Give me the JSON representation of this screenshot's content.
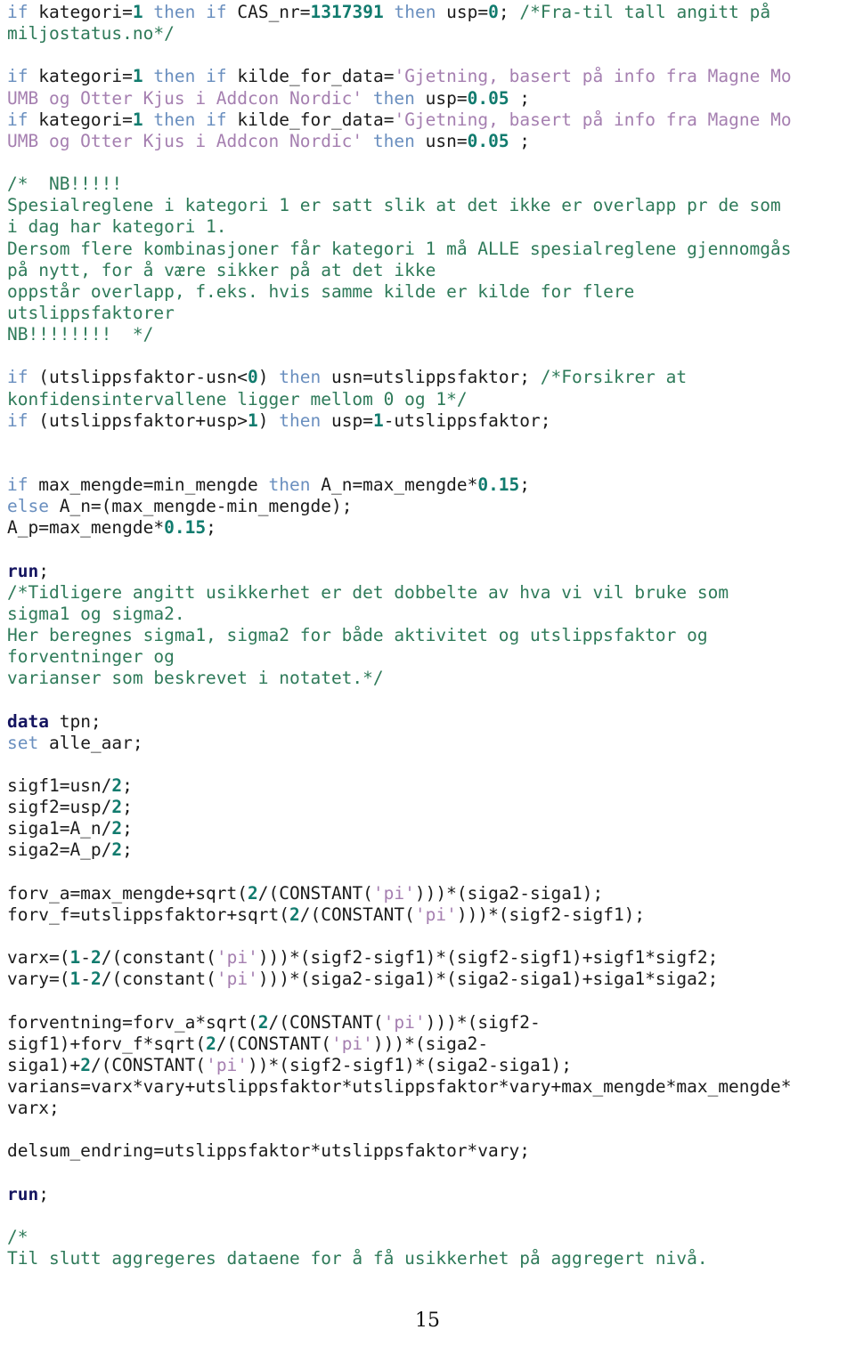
{
  "document": {
    "kind": "sas-code-listing",
    "page_number": "15",
    "colors": {
      "background": "#ffffff",
      "plain_text": "#1b1b1b",
      "keyword": "#6a8fbf",
      "statement": "#151560",
      "number": "#117b6e",
      "string": "#a57fb0",
      "comment": "#2e7a59"
    }
  },
  "code": {
    "lines": [
      {
        "id": "l1",
        "tokens": [
          {
            "t": "if ",
            "c": "kw"
          },
          {
            "t": "kategori=",
            "c": "plain"
          },
          {
            "t": "1",
            "c": "num"
          },
          {
            "t": " ",
            "c": "plain"
          },
          {
            "t": "then",
            "c": "kw"
          },
          {
            "t": " ",
            "c": "plain"
          },
          {
            "t": "if",
            "c": "kw"
          },
          {
            "t": " CAS_nr=",
            "c": "plain"
          },
          {
            "t": "1317391",
            "c": "num"
          },
          {
            "t": " ",
            "c": "plain"
          },
          {
            "t": "then",
            "c": "kw"
          },
          {
            "t": " usp=",
            "c": "plain"
          },
          {
            "t": "0",
            "c": "num"
          },
          {
            "t": "; ",
            "c": "plain"
          },
          {
            "t": "/*Fra-til tall angitt på",
            "c": "cmt"
          }
        ]
      },
      {
        "id": "l2",
        "tokens": [
          {
            "t": "miljostatus.no*/",
            "c": "cmt"
          }
        ]
      },
      {
        "id": "l3",
        "tokens": []
      },
      {
        "id": "l4",
        "tokens": [
          {
            "t": "if ",
            "c": "kw"
          },
          {
            "t": "kategori=",
            "c": "plain"
          },
          {
            "t": "1",
            "c": "num"
          },
          {
            "t": " ",
            "c": "plain"
          },
          {
            "t": "then",
            "c": "kw"
          },
          {
            "t": " ",
            "c": "plain"
          },
          {
            "t": "if",
            "c": "kw"
          },
          {
            "t": " kilde_for_data=",
            "c": "plain"
          },
          {
            "t": "'Gjetning, basert på info fra Magne Mo",
            "c": "str"
          }
        ]
      },
      {
        "id": "l5",
        "tokens": [
          {
            "t": "UMB og Otter Kjus i Addcon Nordic'",
            "c": "str"
          },
          {
            "t": " ",
            "c": "plain"
          },
          {
            "t": "then",
            "c": "kw"
          },
          {
            "t": " usp=",
            "c": "plain"
          },
          {
            "t": "0.05",
            "c": "num"
          },
          {
            "t": " ;",
            "c": "plain"
          }
        ]
      },
      {
        "id": "l6",
        "tokens": [
          {
            "t": "if ",
            "c": "kw"
          },
          {
            "t": "kategori=",
            "c": "plain"
          },
          {
            "t": "1",
            "c": "num"
          },
          {
            "t": " ",
            "c": "plain"
          },
          {
            "t": "then",
            "c": "kw"
          },
          {
            "t": " ",
            "c": "plain"
          },
          {
            "t": "if",
            "c": "kw"
          },
          {
            "t": " kilde_for_data=",
            "c": "plain"
          },
          {
            "t": "'Gjetning, basert på info fra Magne Mo",
            "c": "str"
          }
        ]
      },
      {
        "id": "l7",
        "tokens": [
          {
            "t": "UMB og Otter Kjus i Addcon Nordic'",
            "c": "str"
          },
          {
            "t": " ",
            "c": "plain"
          },
          {
            "t": "then",
            "c": "kw"
          },
          {
            "t": " usn=",
            "c": "plain"
          },
          {
            "t": "0.05",
            "c": "num"
          },
          {
            "t": " ;",
            "c": "plain"
          }
        ]
      },
      {
        "id": "l8",
        "tokens": []
      },
      {
        "id": "l9",
        "tokens": [
          {
            "t": "/*  NB!!!!!",
            "c": "cmt"
          }
        ]
      },
      {
        "id": "l10",
        "tokens": [
          {
            "t": "Spesialreglene i kategori 1 er satt slik at det ikke er overlapp pr de som",
            "c": "cmt"
          }
        ]
      },
      {
        "id": "l11",
        "tokens": [
          {
            "t": "i dag har kategori 1.",
            "c": "cmt"
          }
        ]
      },
      {
        "id": "l12",
        "tokens": [
          {
            "t": "Dersom flere kombinasjoner får kategori 1 må ALLE spesialreglene gjennomgås",
            "c": "cmt"
          }
        ]
      },
      {
        "id": "l13",
        "tokens": [
          {
            "t": "på nytt, for å være sikker på at det ikke",
            "c": "cmt"
          }
        ]
      },
      {
        "id": "l14",
        "tokens": [
          {
            "t": "oppstår overlapp, f.eks. hvis samme kilde er kilde for flere",
            "c": "cmt"
          }
        ]
      },
      {
        "id": "l15",
        "tokens": [
          {
            "t": "utslippsfaktorer",
            "c": "cmt"
          }
        ]
      },
      {
        "id": "l16",
        "tokens": [
          {
            "t": "NB!!!!!!!!  */",
            "c": "cmt"
          }
        ]
      },
      {
        "id": "l17",
        "tokens": []
      },
      {
        "id": "l18",
        "tokens": [
          {
            "t": "if",
            "c": "kw"
          },
          {
            "t": " (utslippsfaktor-usn<",
            "c": "plain"
          },
          {
            "t": "0",
            "c": "num"
          },
          {
            "t": ") ",
            "c": "plain"
          },
          {
            "t": "then",
            "c": "kw"
          },
          {
            "t": " usn=utslippsfaktor; ",
            "c": "plain"
          },
          {
            "t": "/*Forsikrer at",
            "c": "cmt"
          }
        ]
      },
      {
        "id": "l19",
        "tokens": [
          {
            "t": "konfidensintervallene ligger mellom 0 og 1*/",
            "c": "cmt"
          }
        ]
      },
      {
        "id": "l20",
        "tokens": [
          {
            "t": "if",
            "c": "kw"
          },
          {
            "t": " (utslippsfaktor+usp>",
            "c": "plain"
          },
          {
            "t": "1",
            "c": "num"
          },
          {
            "t": ") ",
            "c": "plain"
          },
          {
            "t": "then",
            "c": "kw"
          },
          {
            "t": " usp=",
            "c": "plain"
          },
          {
            "t": "1",
            "c": "num"
          },
          {
            "t": "-utslippsfaktor;",
            "c": "plain"
          }
        ]
      },
      {
        "id": "l21",
        "tokens": []
      },
      {
        "id": "l22",
        "tokens": []
      },
      {
        "id": "l23",
        "tokens": [
          {
            "t": "if",
            "c": "kw"
          },
          {
            "t": " max_mengde=min_mengde ",
            "c": "plain"
          },
          {
            "t": "then",
            "c": "kw"
          },
          {
            "t": " A_n=max_mengde*",
            "c": "plain"
          },
          {
            "t": "0.15",
            "c": "num"
          },
          {
            "t": ";",
            "c": "plain"
          }
        ]
      },
      {
        "id": "l24",
        "tokens": [
          {
            "t": "else",
            "c": "kw"
          },
          {
            "t": " A_n=(max_mengde-min_mengde);",
            "c": "plain"
          }
        ]
      },
      {
        "id": "l25",
        "tokens": [
          {
            "t": "A_p=max_mengde*",
            "c": "plain"
          },
          {
            "t": "0.15",
            "c": "num"
          },
          {
            "t": ";",
            "c": "plain"
          }
        ]
      },
      {
        "id": "l26",
        "tokens": []
      },
      {
        "id": "l27",
        "tokens": [
          {
            "t": "run",
            "c": "stmt"
          },
          {
            "t": ";",
            "c": "plain"
          }
        ]
      },
      {
        "id": "l28",
        "tokens": [
          {
            "t": "/*Tidligere angitt usikkerhet er det dobbelte av hva vi vil bruke som",
            "c": "cmt"
          }
        ]
      },
      {
        "id": "l29",
        "tokens": [
          {
            "t": "sigma1 og sigma2.",
            "c": "cmt"
          }
        ]
      },
      {
        "id": "l30",
        "tokens": [
          {
            "t": "Her beregnes sigma1, sigma2 for både aktivitet og utslippsfaktor og",
            "c": "cmt"
          }
        ]
      },
      {
        "id": "l31",
        "tokens": [
          {
            "t": "forventninger og",
            "c": "cmt"
          }
        ]
      },
      {
        "id": "l32",
        "tokens": [
          {
            "t": "varianser som beskrevet i notatet.*/",
            "c": "cmt"
          }
        ]
      },
      {
        "id": "l33",
        "tokens": []
      },
      {
        "id": "l34",
        "tokens": [
          {
            "t": "data",
            "c": "stmt"
          },
          {
            "t": " tpn;",
            "c": "plain"
          }
        ]
      },
      {
        "id": "l35",
        "tokens": [
          {
            "t": "set",
            "c": "kw"
          },
          {
            "t": " alle_aar;",
            "c": "plain"
          }
        ]
      },
      {
        "id": "l36",
        "tokens": []
      },
      {
        "id": "l37",
        "tokens": [
          {
            "t": "sigf1=usn/",
            "c": "plain"
          },
          {
            "t": "2",
            "c": "num"
          },
          {
            "t": ";",
            "c": "plain"
          }
        ]
      },
      {
        "id": "l38",
        "tokens": [
          {
            "t": "sigf2=usp/",
            "c": "plain"
          },
          {
            "t": "2",
            "c": "num"
          },
          {
            "t": ";",
            "c": "plain"
          }
        ]
      },
      {
        "id": "l39",
        "tokens": [
          {
            "t": "siga1=A_n/",
            "c": "plain"
          },
          {
            "t": "2",
            "c": "num"
          },
          {
            "t": ";",
            "c": "plain"
          }
        ]
      },
      {
        "id": "l40",
        "tokens": [
          {
            "t": "siga2=A_p/",
            "c": "plain"
          },
          {
            "t": "2",
            "c": "num"
          },
          {
            "t": ";",
            "c": "plain"
          }
        ]
      },
      {
        "id": "l41",
        "tokens": []
      },
      {
        "id": "l42",
        "tokens": [
          {
            "t": "forv_a=max_mengde+sqrt(",
            "c": "plain"
          },
          {
            "t": "2",
            "c": "num"
          },
          {
            "t": "/(CONSTANT(",
            "c": "plain"
          },
          {
            "t": "'pi'",
            "c": "str"
          },
          {
            "t": ")))*(siga2-siga1);",
            "c": "plain"
          }
        ]
      },
      {
        "id": "l43",
        "tokens": [
          {
            "t": "forv_f=utslippsfaktor+sqrt(",
            "c": "plain"
          },
          {
            "t": "2",
            "c": "num"
          },
          {
            "t": "/(CONSTANT(",
            "c": "plain"
          },
          {
            "t": "'pi'",
            "c": "str"
          },
          {
            "t": ")))*(sigf2-sigf1);",
            "c": "plain"
          }
        ]
      },
      {
        "id": "l44",
        "tokens": []
      },
      {
        "id": "l45",
        "tokens": [
          {
            "t": "varx=(",
            "c": "plain"
          },
          {
            "t": "1",
            "c": "num"
          },
          {
            "t": "-",
            "c": "plain"
          },
          {
            "t": "2",
            "c": "num"
          },
          {
            "t": "/(constant(",
            "c": "plain"
          },
          {
            "t": "'pi'",
            "c": "str"
          },
          {
            "t": ")))*(sigf2-sigf1)*(sigf2-sigf1)+sigf1*sigf2;",
            "c": "plain"
          }
        ]
      },
      {
        "id": "l46",
        "tokens": [
          {
            "t": "vary=(",
            "c": "plain"
          },
          {
            "t": "1",
            "c": "num"
          },
          {
            "t": "-",
            "c": "plain"
          },
          {
            "t": "2",
            "c": "num"
          },
          {
            "t": "/(constant(",
            "c": "plain"
          },
          {
            "t": "'pi'",
            "c": "str"
          },
          {
            "t": ")))*(siga2-siga1)*(siga2-siga1)+siga1*siga2;",
            "c": "plain"
          }
        ]
      },
      {
        "id": "l47",
        "tokens": []
      },
      {
        "id": "l48",
        "tokens": [
          {
            "t": "forventning=forv_a*sqrt(",
            "c": "plain"
          },
          {
            "t": "2",
            "c": "num"
          },
          {
            "t": "/(CONSTANT(",
            "c": "plain"
          },
          {
            "t": "'pi'",
            "c": "str"
          },
          {
            "t": ")))*(sigf2-",
            "c": "plain"
          }
        ]
      },
      {
        "id": "l49",
        "tokens": [
          {
            "t": "sigf1)+forv_f*sqrt(",
            "c": "plain"
          },
          {
            "t": "2",
            "c": "num"
          },
          {
            "t": "/(CONSTANT(",
            "c": "plain"
          },
          {
            "t": "'pi'",
            "c": "str"
          },
          {
            "t": ")))*(siga2-",
            "c": "plain"
          }
        ]
      },
      {
        "id": "l50",
        "tokens": [
          {
            "t": "siga1)+",
            "c": "plain"
          },
          {
            "t": "2",
            "c": "num"
          },
          {
            "t": "/(CONSTANT(",
            "c": "plain"
          },
          {
            "t": "'pi'",
            "c": "str"
          },
          {
            "t": "))*(sigf2-sigf1)*(siga2-siga1);",
            "c": "plain"
          }
        ]
      },
      {
        "id": "l51",
        "tokens": [
          {
            "t": "varians=varx*vary+utslippsfaktor*utslippsfaktor*vary+max_mengde*max_mengde*",
            "c": "plain"
          }
        ]
      },
      {
        "id": "l52",
        "tokens": [
          {
            "t": "varx;",
            "c": "plain"
          }
        ]
      },
      {
        "id": "l53",
        "tokens": []
      },
      {
        "id": "l54",
        "tokens": [
          {
            "t": "delsum_endring=utslippsfaktor*utslippsfaktor*vary;",
            "c": "plain"
          }
        ]
      },
      {
        "id": "l55",
        "tokens": []
      },
      {
        "id": "l56",
        "tokens": [
          {
            "t": "run",
            "c": "stmt"
          },
          {
            "t": ";",
            "c": "plain"
          }
        ]
      },
      {
        "id": "l57",
        "tokens": []
      },
      {
        "id": "l58",
        "tokens": [
          {
            "t": "/*",
            "c": "cmt"
          }
        ]
      },
      {
        "id": "l59",
        "tokens": [
          {
            "t": "Til slutt aggregeres dataene for å få usikkerhet på aggregert nivå.",
            "c": "cmt"
          }
        ]
      }
    ]
  }
}
